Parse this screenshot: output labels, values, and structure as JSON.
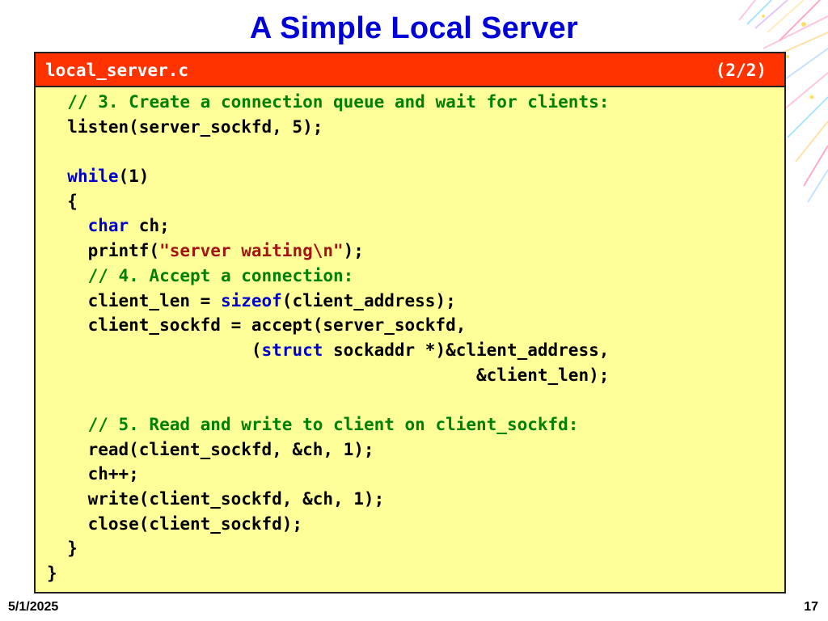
{
  "slide": {
    "title": "A Simple Local Server",
    "date": "5/1/2025",
    "page_number": "17"
  },
  "code_box": {
    "filename": "local_server.c",
    "part": "(2/2)",
    "colors": {
      "header": "#ff3300",
      "body": "#ffff99",
      "comment": "#008000",
      "keyword": "#0000cc",
      "string": "#a31515"
    },
    "lines": [
      [
        {
          "t": "  "
        },
        {
          "t": "// 3. Create a connection queue and wait for clients:",
          "c": "cm"
        }
      ],
      [
        {
          "t": "  listen(server_sockfd, 5);"
        }
      ],
      [
        {
          "t": ""
        }
      ],
      [
        {
          "t": "  "
        },
        {
          "t": "while",
          "c": "kw"
        },
        {
          "t": "(1)"
        }
      ],
      [
        {
          "t": "  {"
        }
      ],
      [
        {
          "t": "    "
        },
        {
          "t": "char",
          "c": "kw"
        },
        {
          "t": " ch;"
        }
      ],
      [
        {
          "t": "    printf("
        },
        {
          "t": "\"server waiting\\n\"",
          "c": "st"
        },
        {
          "t": ");"
        }
      ],
      [
        {
          "t": "    "
        },
        {
          "t": "// 4. Accept a connection:",
          "c": "cm"
        }
      ],
      [
        {
          "t": "    client_len = "
        },
        {
          "t": "sizeof",
          "c": "kw"
        },
        {
          "t": "(client_address);"
        }
      ],
      [
        {
          "t": "    client_sockfd = accept(server_sockfd,"
        }
      ],
      [
        {
          "t": "                    ("
        },
        {
          "t": "struct",
          "c": "kw"
        },
        {
          "t": " sockaddr *)&client_address,"
        }
      ],
      [
        {
          "t": "                                          &client_len);"
        }
      ],
      [
        {
          "t": ""
        }
      ],
      [
        {
          "t": "    "
        },
        {
          "t": "// 5. Read and write to client on client_sockfd:",
          "c": "cm"
        }
      ],
      [
        {
          "t": "    read(client_sockfd, &ch, 1);"
        }
      ],
      [
        {
          "t": "    ch++;"
        }
      ],
      [
        {
          "t": "    write(client_sockfd, &ch, 1);"
        }
      ],
      [
        {
          "t": "    close(client_sockfd);"
        }
      ],
      [
        {
          "t": "  }"
        }
      ],
      [
        {
          "t": "}"
        }
      ]
    ]
  }
}
